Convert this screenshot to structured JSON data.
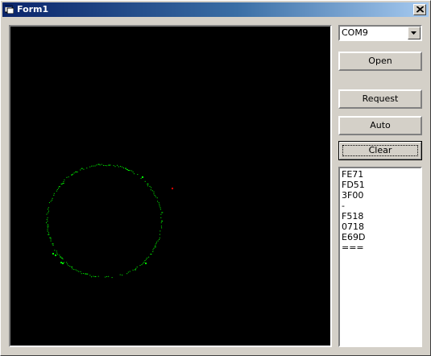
{
  "window": {
    "title": "Form1"
  },
  "controls": {
    "port_select": {
      "value": "COM9"
    },
    "open_label": "Open",
    "request_label": "Request",
    "auto_label": "Auto",
    "clear_label": "Clear"
  },
  "output_list": {
    "items": [
      "FE71",
      "FD51",
      "3F00",
      "-",
      "F518",
      "0718",
      "E69D",
      "==="
    ]
  },
  "display": {
    "background_color": "#000000",
    "trace_color": "#00ff00",
    "marker_color": "#ff0000"
  }
}
